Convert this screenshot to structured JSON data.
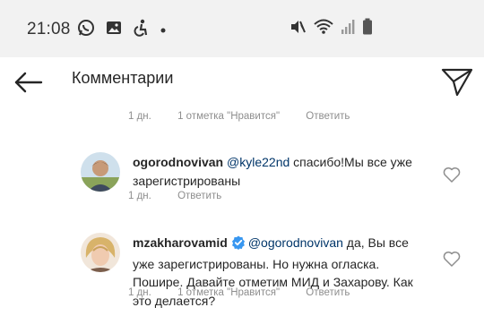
{
  "status_bar": {
    "time": "21:08",
    "left_icons": [
      "whatsapp-icon",
      "gallery-icon",
      "accessibility-icon",
      "dot-icon"
    ],
    "right_icons": [
      "mute-icon",
      "wifi-icon",
      "signal-icon",
      "battery-icon"
    ]
  },
  "header": {
    "title": "Комментарии",
    "back_icon": "arrow-left-icon",
    "share_icon": "paper-plane-icon"
  },
  "comments": [
    {
      "meta": {
        "time": "1 дн.",
        "likes": "1 отметка \"Нравится\"",
        "reply": "Ответить"
      }
    },
    {
      "username": "ogorodnovivan",
      "verified": false,
      "mention": "@kyle22nd",
      "text": " спасибо!Мы все уже зарегистрированы",
      "meta": {
        "time": "1 дн.",
        "reply": "Ответить"
      }
    },
    {
      "username": "mzakharovamid",
      "verified": true,
      "mention": "@ogorodnovivan",
      "text": " да, Вы все уже зарегистрированы. Но нужна огласка. Пошире. Давайте отметим МИД и Захарову. Как это делается?",
      "meta": {
        "time": "1 дн.",
        "likes": "1 отметка \"Нравится\"",
        "reply": "Ответить"
      }
    }
  ],
  "colors": {
    "status_bar_bg": "#f2f2f2",
    "mention": "#003569",
    "meta_text": "#8e8e8e",
    "verified_badge": "#3897f0"
  }
}
